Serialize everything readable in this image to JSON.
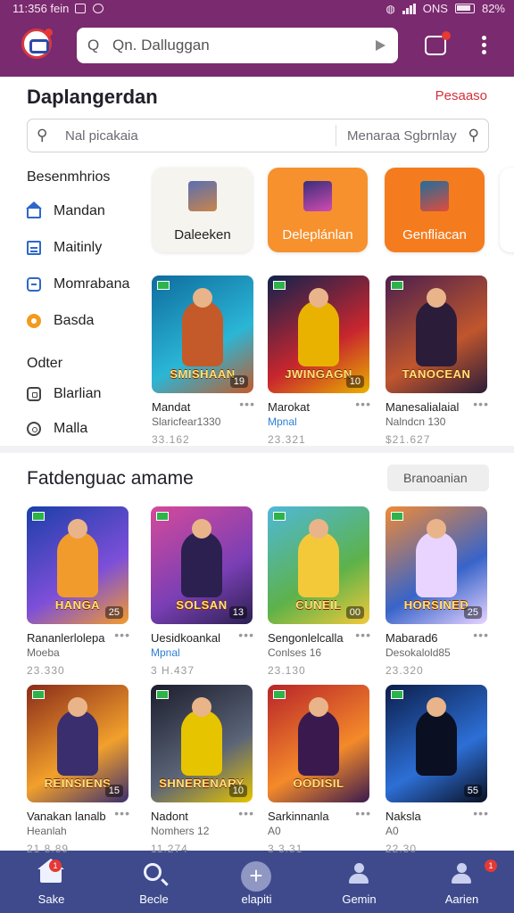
{
  "status_bar": {
    "time": "11:356 fein",
    "right_text": "ONS",
    "battery": "82%"
  },
  "header": {
    "search_placeholder": "Qn. Dalluggan"
  },
  "page": {
    "title": "Daplangerdan",
    "action": "Pesaaso"
  },
  "filter": {
    "placeholder": "Nal picakaia",
    "select_value": "Menaraa Sgbrnlay"
  },
  "sidebar": {
    "section1_title": "Besenmhrios",
    "items": [
      {
        "label": "Mandan",
        "icon": "home-icon"
      },
      {
        "label": "Maitinly",
        "icon": "chart-icon"
      },
      {
        "label": "Momrabana",
        "icon": "lock-icon"
      },
      {
        "label": "Basda",
        "icon": "coin-icon"
      }
    ],
    "section2_title": "Odter",
    "items2": [
      {
        "label": "Blarlian",
        "icon": "box-icon"
      },
      {
        "label": "Malla",
        "icon": "circle-icon"
      }
    ]
  },
  "categories": [
    {
      "label": "Daleeken",
      "color": "#f6f4ef"
    },
    {
      "label": "Deleplánlan",
      "color": "#f6912e"
    },
    {
      "label": "Genfliacan",
      "color": "#f47c1e"
    }
  ],
  "top_games": [
    {
      "caption": "SMISHAAN",
      "badge": "19",
      "name": "Mandat",
      "sub": "Slaricfear1330",
      "meta": "33.162",
      "colors": [
        "#0e6c9e",
        "#2bb6d6",
        "#c45a2a"
      ]
    },
    {
      "caption": "JWINGAGN",
      "badge": "10",
      "name": "Marokat",
      "sub": "Mpnal",
      "meta": "23.321",
      "colors": [
        "#10224e",
        "#c8262e",
        "#e9b200"
      ]
    },
    {
      "caption": "TANOCEAN",
      "badge": "",
      "name": "Manesalialaial",
      "sub": "Nalndcn 130",
      "meta": "$21.627",
      "colors": [
        "#4b1f4e",
        "#c0562d",
        "#2b1d3a"
      ]
    }
  ],
  "section": {
    "title": "Fatdenguac amame",
    "button": "Branoanian"
  },
  "grid_games": [
    {
      "caption": "HANGA",
      "badge": "25",
      "name": "Rananlerlolepa",
      "sub": "Moeba",
      "meta": "23.330",
      "colors": [
        "#1b3fa8",
        "#7d4fd9",
        "#f29b2d"
      ]
    },
    {
      "caption": "SOLSAN",
      "badge": "13",
      "name": "Uesidkoankal",
      "sub": "Mpnal",
      "meta": "3 H.437",
      "colors": [
        "#d54a9a",
        "#7a3fb5",
        "#2b2050"
      ]
    },
    {
      "caption": "CUNEIL",
      "badge": "00",
      "name": "Sengonlelcalla",
      "sub": "Conlses 16",
      "meta": "23.130",
      "colors": [
        "#4fb8d9",
        "#5db24a",
        "#f3c93a"
      ]
    },
    {
      "caption": "HORSINED",
      "badge": "25",
      "name": "Mabarad6",
      "sub": "Desokalold85",
      "meta": "23.320",
      "colors": [
        "#f08a36",
        "#3864c9",
        "#e8d4ff"
      ]
    },
    {
      "caption": "REINSIENS",
      "badge": "15",
      "name": "Vanakan lanalb",
      "sub": "Heanlah",
      "meta": "21 8.89",
      "colors": [
        "#8a2b1a",
        "#f2a02c",
        "#3a2e6e"
      ]
    },
    {
      "caption": "SHNERENARY",
      "badge": "10",
      "name": "Nadont",
      "sub": "Nomhers 12",
      "meta": "11.274",
      "colors": [
        "#1b1d2c",
        "#5b6478",
        "#e6c400"
      ]
    },
    {
      "caption": "OODISIL",
      "badge": "",
      "name": "Sarkinnanla",
      "sub": "A0",
      "meta": "3 3.31",
      "colors": [
        "#b8232a",
        "#f48a2a",
        "#3a1a4e"
      ]
    },
    {
      "caption": "",
      "badge": "55",
      "name": "Naksla",
      "sub": "A0",
      "meta": "22.30",
      "colors": [
        "#0c1e4a",
        "#2d6fd6",
        "#0a0f22"
      ]
    }
  ],
  "bottom_nav": [
    {
      "label": "Sake",
      "icon": "home-icon",
      "badge": "1"
    },
    {
      "label": "Becle",
      "icon": "search-icon",
      "badge": ""
    },
    {
      "label": "elapiti",
      "icon": "plus-icon",
      "badge": ""
    },
    {
      "label": "Gemin",
      "icon": "user-icon",
      "badge": ""
    },
    {
      "label": "Aarien",
      "icon": "user-icon",
      "badge": "1"
    }
  ]
}
